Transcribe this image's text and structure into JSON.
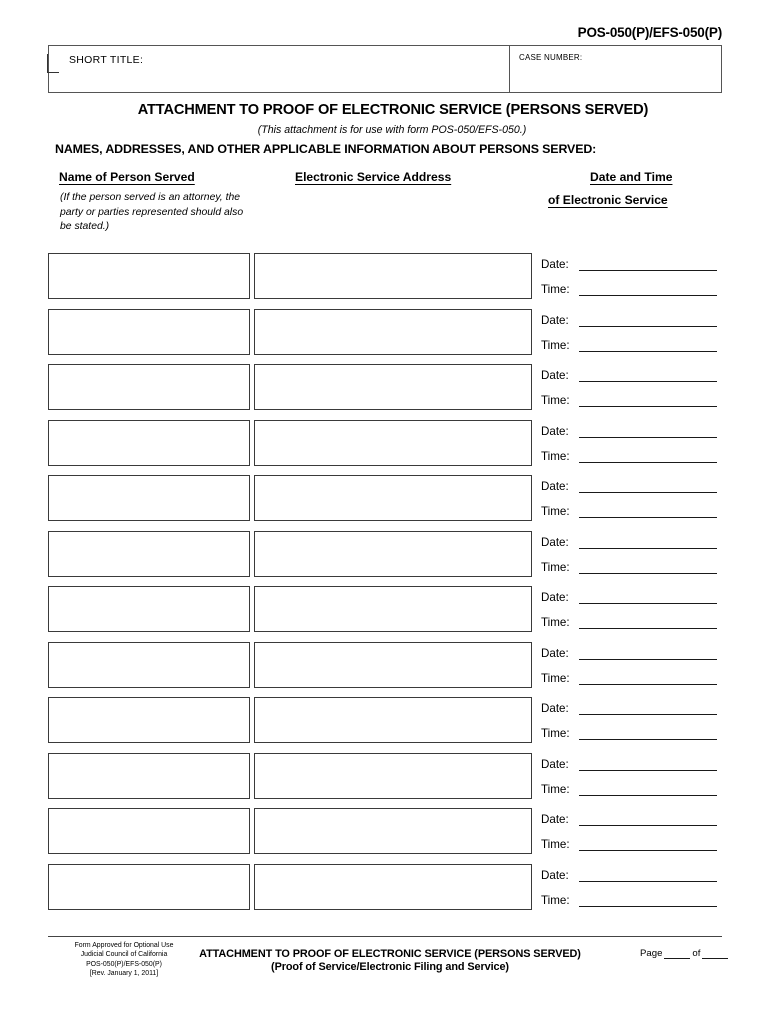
{
  "form": {
    "form_number": "POS-050(P)/EFS-050(P)",
    "short_title_label": "SHORT TITLE:",
    "case_number_label": "CASE NUMBER:",
    "short_title_value": "",
    "case_number_value": ""
  },
  "titles": {
    "main": "ATTACHMENT TO PROOF OF ELECTRONIC SERVICE (PERSONS SERVED)",
    "subtitle": "(This attachment is for use with form POS-050/EFS-050.)",
    "section": "NAMES, ADDRESSES, AND OTHER APPLICABLE INFORMATION ABOUT PERSONS SERVED:"
  },
  "columns": {
    "name_header": "Name of Person Served",
    "name_note": "(If the person served is an attorney, the party or parties represented should also be stated.)",
    "address_header": "Electronic Service Address",
    "datetime_header_line1": "Date and Time",
    "datetime_header_line2": "of Electronic Service",
    "date_label": "Date:",
    "time_label": "Time:"
  },
  "rows": [
    {
      "name": "",
      "address": "",
      "date": "",
      "time": ""
    },
    {
      "name": "",
      "address": "",
      "date": "",
      "time": ""
    },
    {
      "name": "",
      "address": "",
      "date": "",
      "time": ""
    },
    {
      "name": "",
      "address": "",
      "date": "",
      "time": ""
    },
    {
      "name": "",
      "address": "",
      "date": "",
      "time": ""
    },
    {
      "name": "",
      "address": "",
      "date": "",
      "time": ""
    },
    {
      "name": "",
      "address": "",
      "date": "",
      "time": ""
    },
    {
      "name": "",
      "address": "",
      "date": "",
      "time": ""
    },
    {
      "name": "",
      "address": "",
      "date": "",
      "time": ""
    },
    {
      "name": "",
      "address": "",
      "date": "",
      "time": ""
    },
    {
      "name": "",
      "address": "",
      "date": "",
      "time": ""
    },
    {
      "name": "",
      "address": "",
      "date": "",
      "time": ""
    }
  ],
  "footer": {
    "approval_line1": "Form Approved for Optional Use",
    "approval_line2": "Judicial Council of California",
    "approval_line3": "POS-050(P)/EFS-050(P)",
    "approval_line4": "[Rev. January 1,  2011]",
    "center_line1": "ATTACHMENT TO PROOF OF ELECTRONIC SERVICE (PERSONS SERVED)",
    "center_line2": "(Proof of Service/Electronic Filing and Service)",
    "page_word": "Page",
    "of_word": "of",
    "page_current": "",
    "page_total": ""
  }
}
